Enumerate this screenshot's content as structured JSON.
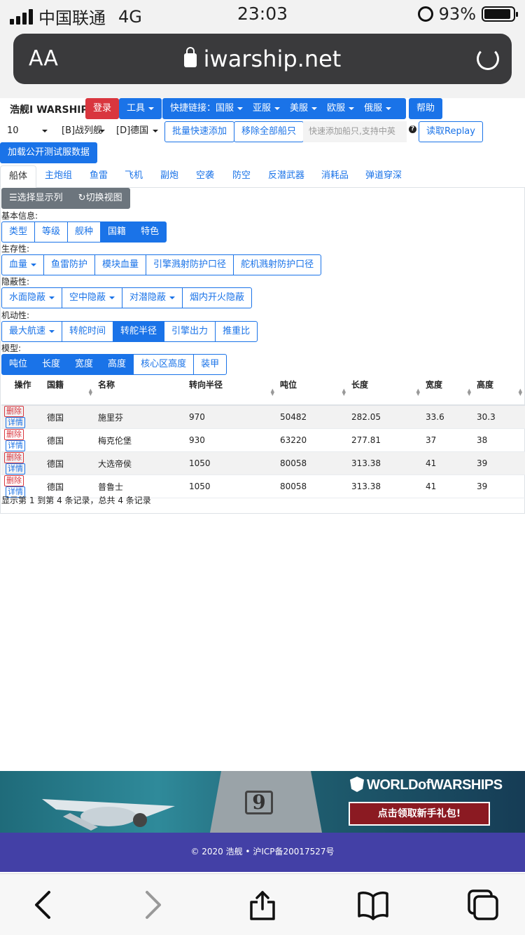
{
  "status": {
    "carrier": "中国联通",
    "network": "4G",
    "time": "23:03",
    "battery": "93%",
    "battery_level": 0.93
  },
  "browser": {
    "text_size": "AA",
    "url": "iwarship.net"
  },
  "site": {
    "logo": "浩舰I WARSHIP",
    "login": "登录",
    "tools": "工具",
    "quicklinks_label": "快捷链接：",
    "regions": [
      "国服",
      "亚服",
      "美服",
      "欧服",
      "俄服"
    ],
    "help": "帮助",
    "tier_select": "10",
    "type_select": "[B]战列舰",
    "nation_select": "[D]德国",
    "batch_add": "批量快速添加",
    "remove_all": "移除全部船只",
    "quick_add_placeholder": "快速添加船只,支持中英",
    "read_replay": "读取Replay",
    "load_test_server": "加载公开测试服数据"
  },
  "tabs": [
    "船体",
    "主炮组",
    "鱼雷",
    "飞机",
    "副炮",
    "空袭",
    "防空",
    "反潜武器",
    "消耗品",
    "弹道穿深"
  ],
  "toolbar": {
    "select_columns": "选择显示列",
    "switch_view": "切换视图"
  },
  "sections": {
    "basic_label": "基本信息:",
    "basic": [
      "类型",
      "等级",
      "舰种",
      "国籍",
      "特色"
    ],
    "survival_label": "生存性:",
    "survival": [
      "血量",
      "鱼雷防护",
      "模块血量",
      "引擎溅射防护口径",
      "舵机溅射防护口径"
    ],
    "stealth_label": "隐蔽性:",
    "stealth": [
      "水面隐蔽",
      "空中隐蔽",
      "对潜隐蔽",
      "烟内开火隐蔽"
    ],
    "mobility_label": "机动性:",
    "mobility": [
      "最大航速",
      "转舵时间",
      "转舵半径",
      "引擎出力",
      "推重比"
    ],
    "model_label": "模型:",
    "model": [
      "吨位",
      "长度",
      "宽度",
      "高度",
      "核心区高度",
      "装甲"
    ]
  },
  "table": {
    "headers": [
      "操作",
      "国籍",
      "名称",
      "转向半径",
      "吨位",
      "长度",
      "宽度",
      "高度"
    ],
    "delete_label": "删除",
    "detail_label": "详情",
    "rows": [
      [
        "德国",
        "施里芬",
        "970",
        "50482",
        "282.05",
        "33.6",
        "30.3"
      ],
      [
        "德国",
        "梅克伦堡",
        "930",
        "63220",
        "277.81",
        "37",
        "38"
      ],
      [
        "德国",
        "大选帝侯",
        "1050",
        "80058",
        "313.38",
        "41",
        "39"
      ],
      [
        "德国",
        "普鲁士",
        "1050",
        "80058",
        "313.38",
        "41",
        "39"
      ]
    ],
    "pagination": "显示第 1 到第 4 条记录，总共 4 条记录"
  },
  "banner": {
    "brand": "WORLDofWARSHIPS",
    "cta": "点击领取新手礼包!",
    "ship_number": "9"
  },
  "footer": "© 2020 浩舰 • 沪ICP备20017527号"
}
